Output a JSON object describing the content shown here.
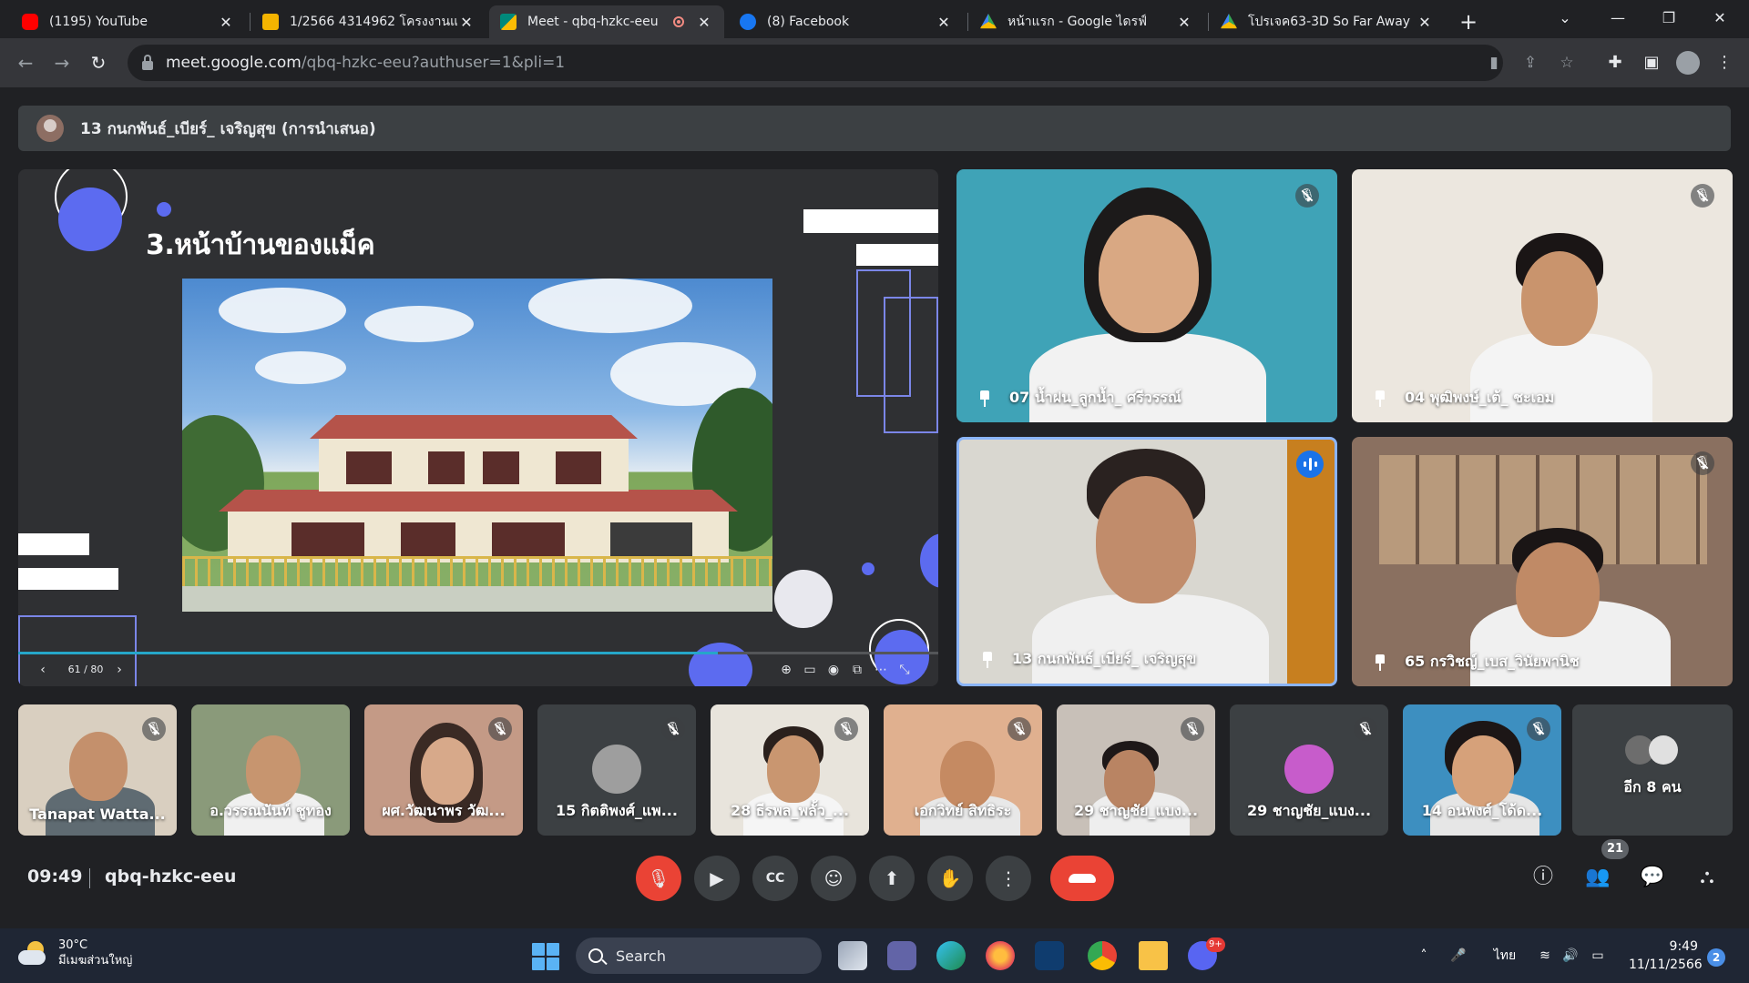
{
  "browser": {
    "tabs": [
      {
        "title": "(1195) YouTube",
        "fav_color": "#ff0000"
      },
      {
        "title": "1/2566 4314962 โครงงานแ",
        "fav_color": "#f4b400"
      },
      {
        "title": "Meet - qbq-hzkc-eeu",
        "fav_color": "#00897b"
      },
      {
        "title": "(8) Facebook",
        "fav_color": "#1877f2"
      },
      {
        "title": "หน้าแรก - Google ไดรฟ์",
        "fav_color": "#fbbc04"
      },
      {
        "title": "โปรเจค63-3D So Far Away",
        "fav_color": "#fbbc04"
      }
    ],
    "url_host": "meet.google.com",
    "url_path": "/qbq-hzkc-eeu?authuser=1&pli=1"
  },
  "meet": {
    "presenter_label": "13 กนกพันธ์_เบียร์_ เจริญสุข (การนำเสนอ)",
    "slide": {
      "title": "3.หน้าบ้านของแม็ค",
      "page_counter": "61 / 80",
      "progress": 0.76
    },
    "main_tiles": [
      {
        "name": "07 น้ำฝน_ลูกน้ำ_ ศรีวรรณ์"
      },
      {
        "name": "04 พุฒิพงษ์_เต้_ ชะเอม"
      },
      {
        "name": "13 กนกพันธ์_เบียร์_ เจริญสุข"
      },
      {
        "name": "65 กรวิชญ์_เบส_วินัยพานิช"
      }
    ],
    "strip_tiles": [
      {
        "name": "Tanapat Watta..."
      },
      {
        "name": "อ.วรรณนันท์ ชูทอง"
      },
      {
        "name": "ผศ.วัฒนาพร วัฒ..."
      },
      {
        "name": "15 กิตติพงศ์_แพ..."
      },
      {
        "name": "28 ธีรพล_พลั้ว_..."
      },
      {
        "name": "เอกวิทย์ สิทธิระ"
      },
      {
        "name": "29 ชาญชัย_แบง..."
      },
      {
        "name": "29 ชาญชัย_แบง..."
      },
      {
        "name": "14 อนพงศ์_โด้ด..."
      }
    ],
    "more_label": "อีก 8 คน",
    "clock": "09:49",
    "meeting_code": "qbq-hzkc-eeu",
    "participant_count": "21"
  },
  "taskbar": {
    "temperature": "30°C",
    "weather_desc": "มีเมฆส่วนใหญ่",
    "search_label": "Search",
    "lang": "ไทย",
    "time": "9:49",
    "date": "11/11/2566",
    "notifications": "2",
    "discord_badge": "9+"
  }
}
